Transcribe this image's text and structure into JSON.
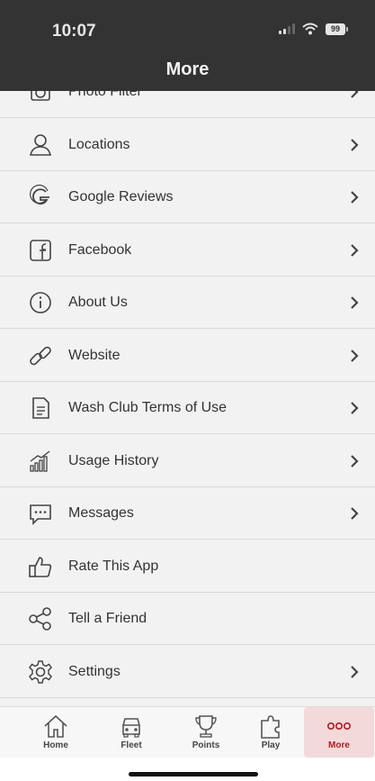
{
  "status_bar": {
    "time": "10:07",
    "battery": "99"
  },
  "header": {
    "title": "More"
  },
  "menu": [
    {
      "label": "Photo Filter",
      "icon": "camera-icon",
      "chevron": true
    },
    {
      "label": "Locations",
      "icon": "user-icon",
      "chevron": true
    },
    {
      "label": "Google Reviews",
      "icon": "google-icon",
      "chevron": true
    },
    {
      "label": "Facebook",
      "icon": "facebook-icon",
      "chevron": true
    },
    {
      "label": "About Us",
      "icon": "info-icon",
      "chevron": true
    },
    {
      "label": "Website",
      "icon": "link-icon",
      "chevron": true
    },
    {
      "label": "Wash Club Terms of Use",
      "icon": "document-icon",
      "chevron": true
    },
    {
      "label": "Usage History",
      "icon": "chart-icon",
      "chevron": true
    },
    {
      "label": "Messages",
      "icon": "message-icon",
      "chevron": true
    },
    {
      "label": "Rate This App",
      "icon": "thumbs-up-icon",
      "chevron": false
    },
    {
      "label": "Tell a Friend",
      "icon": "share-icon",
      "chevron": false
    },
    {
      "label": "Settings",
      "icon": "gear-icon",
      "chevron": true
    }
  ],
  "tabs": [
    {
      "label": "Home",
      "icon": "home-icon",
      "active": false
    },
    {
      "label": "Fleet",
      "icon": "car-icon",
      "active": false
    },
    {
      "label": "Points",
      "icon": "trophy-icon",
      "active": false
    },
    {
      "label": "Play",
      "icon": "puzzle-icon",
      "active": false
    },
    {
      "label": "More",
      "icon": "more-icon",
      "active": true
    }
  ],
  "colors": {
    "header_bg": "#333333",
    "accent": "#b11a21",
    "active_tab_bg": "#f3d9da"
  }
}
